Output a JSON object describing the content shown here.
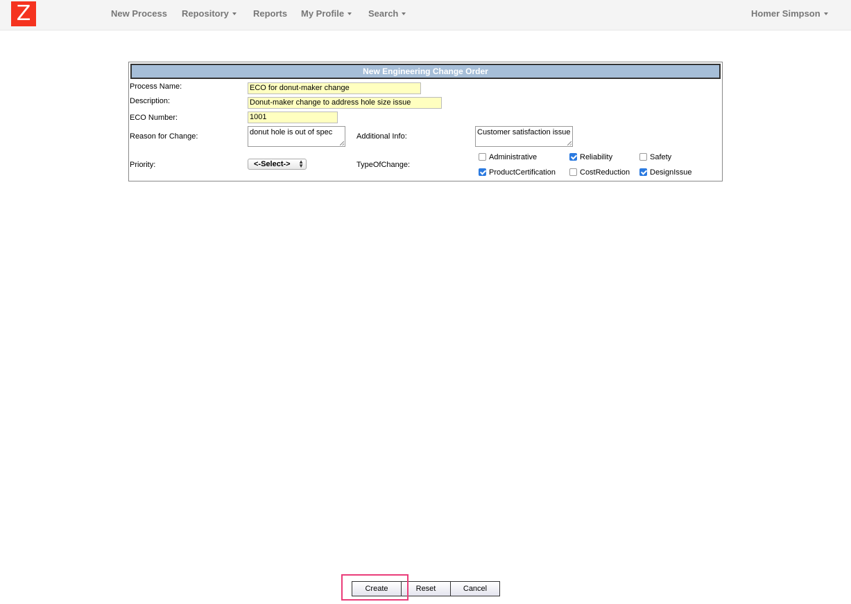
{
  "navbar": {
    "logo_letter": "Z",
    "items": [
      {
        "label": "New Process",
        "has_dropdown": false
      },
      {
        "label": "Repository",
        "has_dropdown": true
      },
      {
        "label": "Reports",
        "has_dropdown": false
      },
      {
        "label": "My Profile",
        "has_dropdown": true
      },
      {
        "label": "Search",
        "has_dropdown": true
      }
    ],
    "user": "Homer Simpson",
    "logo_color": "#f5331f"
  },
  "form": {
    "title": "New Engineering Change Order",
    "header_color": "#a6bed8",
    "fields": {
      "process_name": {
        "label": "Process Name:",
        "value": "ECO for donut-maker change"
      },
      "description": {
        "label": "Description:",
        "value": "Donut-maker change to address hole size issue"
      },
      "eco_number": {
        "label": "ECO Number:",
        "value": "1001"
      },
      "reason": {
        "label": "Reason for Change:",
        "value": "donut hole is out of spec"
      },
      "additional_info": {
        "label": "Additional Info:",
        "value": "Customer satisfaction issue"
      },
      "priority": {
        "label": "Priority:",
        "value": "<-Select->"
      },
      "type_of_change": {
        "label": "TypeOfChange:"
      }
    },
    "change_types": [
      {
        "label": "Administrative",
        "checked": false
      },
      {
        "label": "Reliability",
        "checked": true
      },
      {
        "label": "Safety",
        "checked": false
      },
      {
        "label": "ProductCertification",
        "checked": true
      },
      {
        "label": "CostReduction",
        "checked": false
      },
      {
        "label": "DesignIssue",
        "checked": true
      }
    ],
    "input_bg_color": "#ffffc0",
    "checkbox_checked_color": "#2b7ae0"
  },
  "actions": {
    "create": "Create",
    "reset": "Reset",
    "cancel": "Cancel",
    "highlight_color": "#ea3c79"
  }
}
